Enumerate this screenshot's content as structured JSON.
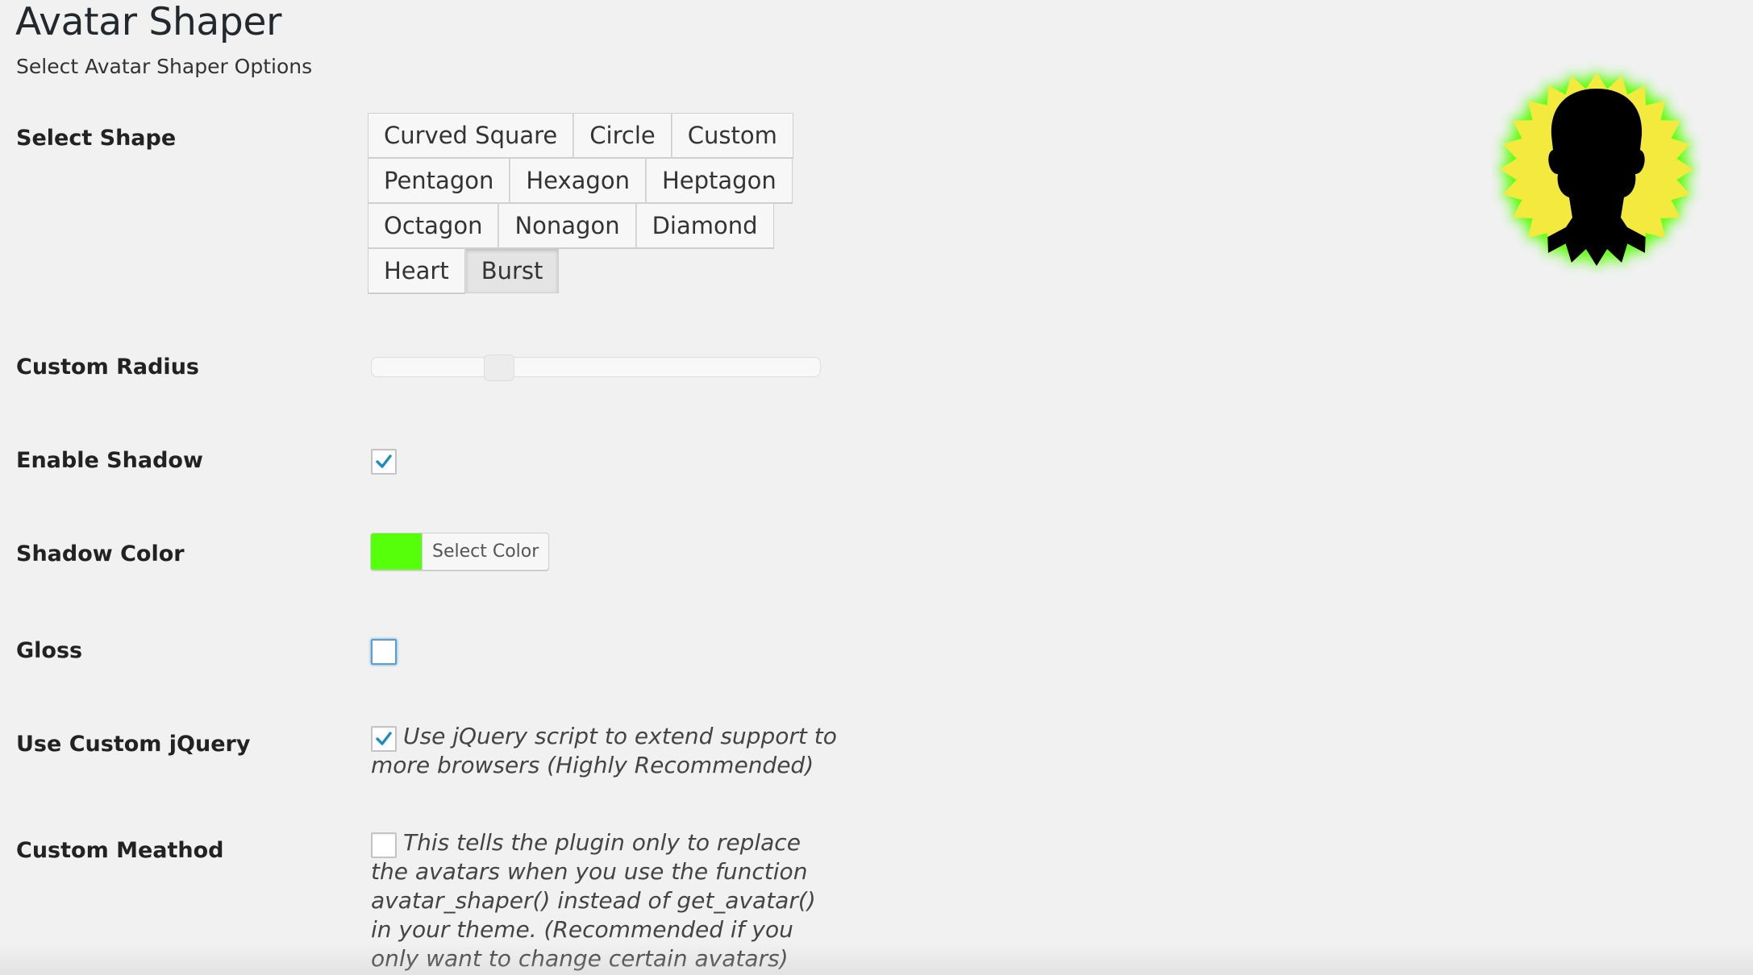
{
  "header": {
    "title": "Avatar Shaper",
    "subtitle": "Select Avatar Shaper Options"
  },
  "settings": {
    "select_shape": {
      "label": "Select Shape",
      "rows": [
        [
          "Curved Square",
          "Circle",
          "Custom"
        ],
        [
          "Pentagon",
          "Hexagon",
          "Heptagon"
        ],
        [
          "Octagon",
          "Nonagon",
          "Diamond"
        ],
        [
          "Heart",
          "Burst"
        ]
      ],
      "selected": "Burst"
    },
    "custom_radius": {
      "label": "Custom Radius",
      "value_fraction": 0.285
    },
    "enable_shadow": {
      "label": "Enable Shadow",
      "checked": true
    },
    "shadow_color": {
      "label": "Shadow Color",
      "button_label": "Select Color",
      "color": "#56ff0a"
    },
    "gloss": {
      "label": "Gloss",
      "checked": false
    },
    "use_custom_jquery": {
      "label": "Use Custom jQuery",
      "checked": true,
      "description": "Use jQuery script to extend support to more browsers (Highly Recommended)"
    },
    "custom_meathod": {
      "label": "Custom Meathod",
      "checked": false,
      "description": "This tells the plugin only to replace the avatars when you use the function avatar_shaper() instead of get_avatar() in your theme. (Recommended if you only want to change certain avatars)"
    }
  },
  "preview": {
    "icon": "burst-avatar-silhouette-icon",
    "burst_color": "#f3ea3c",
    "glow_color": "#56ff0a",
    "silhouette_color": "#000000"
  },
  "colors": {
    "checkmark": "#1e8cbe",
    "background": "#f1f1f1"
  }
}
